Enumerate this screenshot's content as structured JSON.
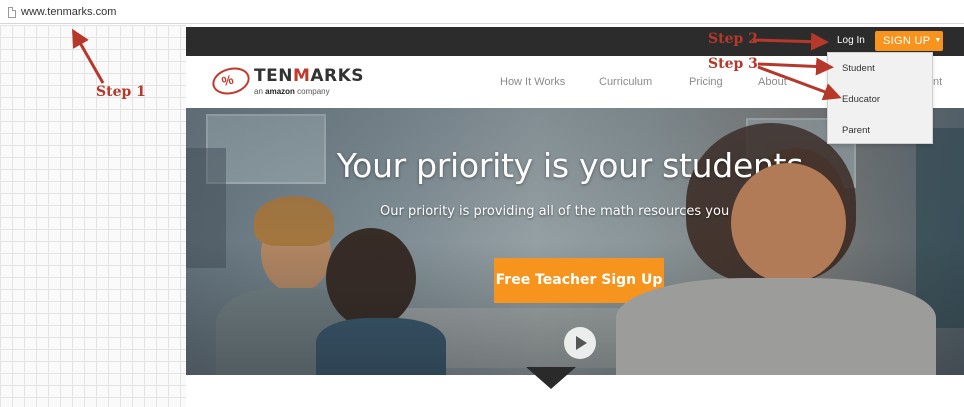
{
  "browser": {
    "url": "www.tenmarks.com",
    "page_icon": "document-icon"
  },
  "site": {
    "topbar": {
      "login_label": "Log In",
      "signup_label": "SIGN UP",
      "signup_color": "#f7941d"
    },
    "logo": {
      "brand_prefix": "TEN",
      "brand_m": "M",
      "brand_suffix": "ARKS",
      "sub_prefix": "an",
      "sub_amazon": "amazon",
      "sub_suffix": "company",
      "brand_color": "#c0392b"
    },
    "nav": [
      {
        "label": "How It Works"
      },
      {
        "label": "Curriculum"
      },
      {
        "label": "Pricing"
      },
      {
        "label": "About"
      }
    ],
    "nav_clipped": "nt",
    "dropdown": [
      {
        "label": "Student"
      },
      {
        "label": "Educator"
      },
      {
        "label": "Parent"
      }
    ],
    "hero": {
      "headline": "Your priority is your students.",
      "subheadline": "Our priority is providing all of the math resources you need.",
      "cta_label": "Free Teacher Sign Up",
      "play_icon": "play-icon"
    }
  },
  "annotations": {
    "step1": "Step 1",
    "step2": "Step 2",
    "step3": "Step 3",
    "color": "#b5382a"
  }
}
